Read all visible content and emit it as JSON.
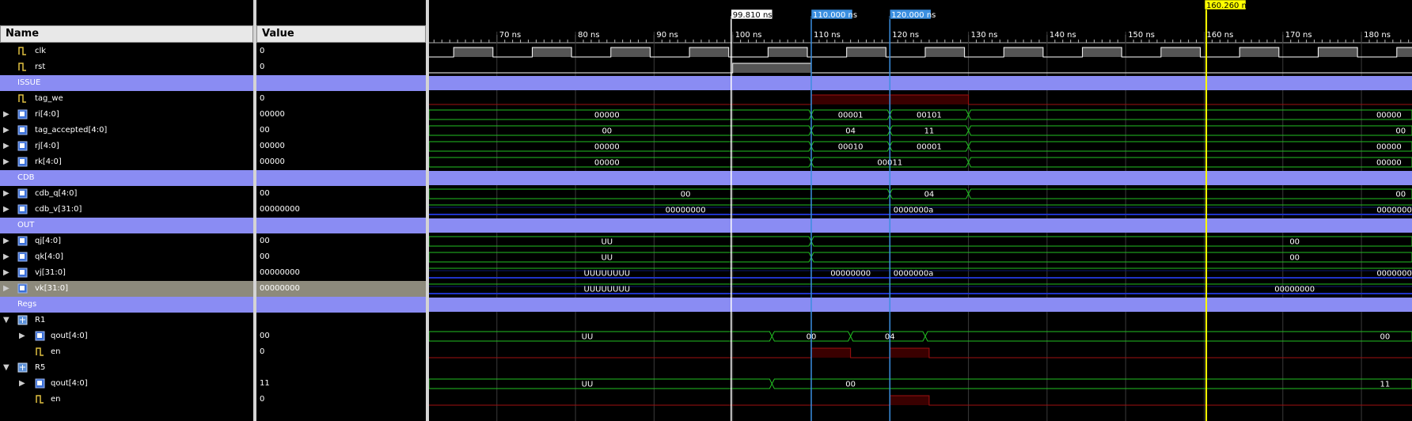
{
  "columns": {
    "name_header": "Name",
    "value_header": "Value"
  },
  "signals": [
    {
      "name": "clk",
      "value": "0",
      "kind": "bit",
      "indent": 1
    },
    {
      "name": "rst",
      "value": "0",
      "kind": "bit",
      "indent": 1
    },
    {
      "name": "ISSUE",
      "value": "",
      "kind": "group",
      "indent": 0
    },
    {
      "name": "tag_we",
      "value": "0",
      "kind": "bit",
      "indent": 1
    },
    {
      "name": "ri[4:0]",
      "value": "00000",
      "kind": "bus",
      "indent": 1
    },
    {
      "name": "tag_accepted[4:0]",
      "value": "00",
      "kind": "bus",
      "indent": 1
    },
    {
      "name": "rj[4:0]",
      "value": "00000",
      "kind": "bus",
      "indent": 1
    },
    {
      "name": "rk[4:0]",
      "value": "00000",
      "kind": "bus",
      "indent": 1
    },
    {
      "name": "CDB",
      "value": "",
      "kind": "group",
      "indent": 0
    },
    {
      "name": "cdb_q[4:0]",
      "value": "00",
      "kind": "bus",
      "indent": 1
    },
    {
      "name": "cdb_v[31:0]",
      "value": "00000000",
      "kind": "bus",
      "indent": 1
    },
    {
      "name": "OUT",
      "value": "",
      "kind": "group",
      "indent": 0
    },
    {
      "name": "qj[4:0]",
      "value": "00",
      "kind": "bus",
      "indent": 1
    },
    {
      "name": "qk[4:0]",
      "value": "00",
      "kind": "bus",
      "indent": 1
    },
    {
      "name": "vj[31:0]",
      "value": "00000000",
      "kind": "bus",
      "indent": 1
    },
    {
      "name": "vk[31:0]",
      "value": "00000000",
      "kind": "bus",
      "indent": 1,
      "selected": true
    },
    {
      "name": "Regs",
      "value": "",
      "kind": "group",
      "indent": 0
    },
    {
      "name": "R1",
      "value": "",
      "kind": "module",
      "indent": 0
    },
    {
      "name": "qout[4:0]",
      "value": "00",
      "kind": "bus",
      "indent": 2
    },
    {
      "name": "en",
      "value": "0",
      "kind": "bit",
      "indent": 2
    },
    {
      "name": "R5",
      "value": "",
      "kind": "module",
      "indent": 0
    },
    {
      "name": "qout[4:0]",
      "value": "11",
      "kind": "bus",
      "indent": 2
    },
    {
      "name": "en",
      "value": "0",
      "kind": "bit",
      "indent": 2
    }
  ],
  "timeline": {
    "tick_labels": [
      "70 ns",
      "80 ns",
      "90 ns",
      "100 ns",
      "110 ns",
      "120 ns",
      "130 ns",
      "140 ns",
      "150 ns",
      "160 ns",
      "170 ns",
      "180 ns"
    ],
    "cursors": [
      {
        "label": "99.810 ns",
        "color": "#ffffff"
      },
      {
        "label": "110.000 ns",
        "color": "#3b8fe0"
      },
      {
        "label": "120.000 ns",
        "color": "#3b8fe0"
      },
      {
        "label": "160.260 ns",
        "color": "#ffff00"
      }
    ]
  },
  "wave_labels": {
    "ri": [
      "00000",
      "00001",
      "00101",
      "00000"
    ],
    "tag_accepted": [
      "00",
      "04",
      "11",
      "00"
    ],
    "rj": [
      "00000",
      "00010",
      "00001",
      "00000"
    ],
    "rk": [
      "00000",
      "00011",
      "00000"
    ],
    "cdb_q": [
      "00",
      "04",
      "00"
    ],
    "cdb_v": [
      "00000000",
      "0000000a",
      "00000000"
    ],
    "qj": [
      "UU",
      "00"
    ],
    "qk": [
      "UU",
      "00"
    ],
    "vj": [
      "UUUUUUUU",
      "00000000",
      "0000000a",
      "00000000"
    ],
    "vk": [
      "UUUUUUUU",
      "00000000"
    ],
    "r1_qout": [
      "UU",
      "00",
      "04",
      "00"
    ],
    "r5_qout": [
      "UU",
      "00",
      "11"
    ]
  },
  "colors": {
    "group": "#8a8cf3",
    "bus": "#22c022",
    "bit_high_fill": "#555555",
    "bit_line": "#ffffff",
    "zero_line": "#a01010",
    "xbus": "#1f33c8"
  }
}
